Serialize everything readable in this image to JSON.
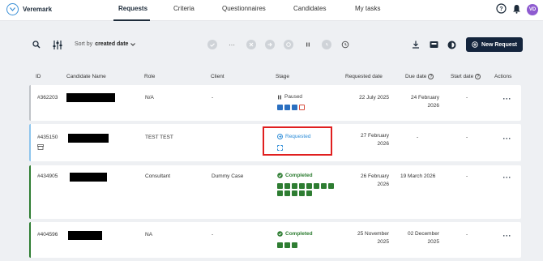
{
  "brand": {
    "name": "Veremark"
  },
  "nav": {
    "tabs": [
      {
        "label": "Requests"
      },
      {
        "label": "Criteria"
      },
      {
        "label": "Questionnaires"
      },
      {
        "label": "Candidates"
      },
      {
        "label": "My tasks"
      }
    ],
    "avatar_initials": "VD"
  },
  "toolbar": {
    "sort_prefix": "Sort by",
    "sort_value": "created date",
    "new_request_label": "New Request"
  },
  "table": {
    "columns": {
      "id": "ID",
      "candidate": "Candidate Name",
      "role": "Role",
      "client": "Client",
      "stage": "Stage",
      "requested": "Requested date",
      "due": "Due date",
      "start": "Start date",
      "actions": "Actions"
    },
    "rows": [
      {
        "id": "#362203",
        "role": "N/A",
        "client": "-",
        "stage": "Paused",
        "requested": "22 July 2025",
        "due": "24 February 2026",
        "start": "-"
      },
      {
        "id": "#435150",
        "role": "TEST TEST",
        "client": "",
        "stage": "Requested",
        "requested": "27 February 2026",
        "due": "-",
        "start": "-"
      },
      {
        "id": "#434905",
        "role": "Consultant",
        "client": "Dummy Case",
        "stage": "Completed",
        "requested": "26 February 2026",
        "due": "19 March 2026",
        "start": "-"
      },
      {
        "id": "#404596",
        "role": "NA",
        "client": "-",
        "stage": "Completed",
        "requested": "25 November 2025",
        "due": "02 December 2025",
        "start": "-"
      }
    ]
  },
  "colors": {
    "navy": "#14253d",
    "completed": "#2e7d32",
    "requested": "#2a8bd7",
    "highlight": "#e01f1f"
  }
}
